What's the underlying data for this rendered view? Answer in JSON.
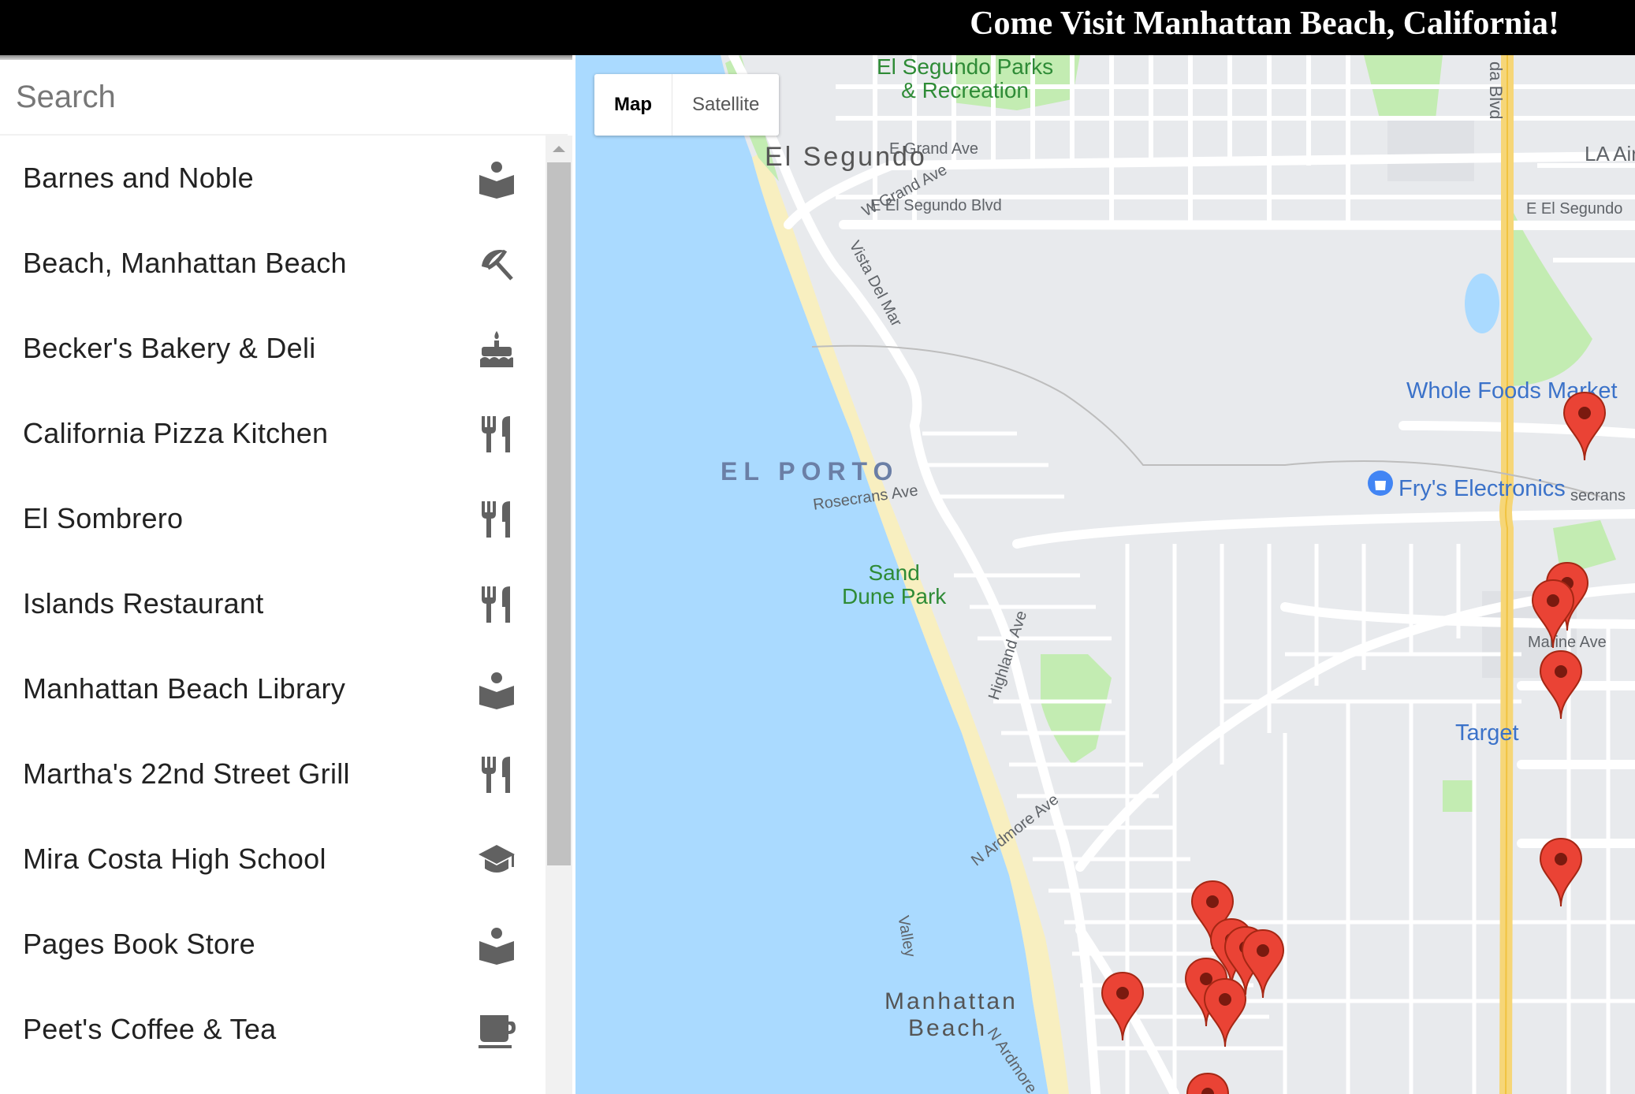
{
  "header": {
    "title": "Come Visit Manhattan Beach, California!"
  },
  "search": {
    "placeholder": "Search"
  },
  "places": [
    {
      "name": "Barnes and Noble",
      "icon": "book-icon"
    },
    {
      "name": "Beach, Manhattan Beach",
      "icon": "beach-umbrella-icon"
    },
    {
      "name": "Becker's Bakery & Deli",
      "icon": "cake-icon"
    },
    {
      "name": "California Pizza Kitchen",
      "icon": "restaurant-icon"
    },
    {
      "name": "El Sombrero",
      "icon": "restaurant-icon"
    },
    {
      "name": "Islands Restaurant",
      "icon": "restaurant-icon"
    },
    {
      "name": "Manhattan Beach Library",
      "icon": "book-icon"
    },
    {
      "name": "Martha's 22nd Street Grill",
      "icon": "restaurant-icon"
    },
    {
      "name": "Mira Costa High School",
      "icon": "school-icon"
    },
    {
      "name": "Pages Book Store",
      "icon": "book-icon"
    },
    {
      "name": "Peet's Coffee & Tea",
      "icon": "coffee-icon"
    }
  ],
  "map": {
    "map_type_buttons": {
      "map": "Map",
      "satellite": "Satellite"
    },
    "labels": {
      "el_segundo_parks_1": "El Segundo Parks",
      "el_segundo_parks_2": "& Recreation",
      "el_segundo": "El Segundo",
      "e_grand_ave": "E Grand Ave",
      "la_air": "LA Air",
      "w_grand_ave": "W Grand Ave",
      "e_el_segundo_blvd": "E El Segundo Blvd",
      "e_el_segundo_right": "E El Segundo",
      "vista_del_mar": "Vista Del Mar",
      "da_blvd": "da Blvd",
      "whole_foods": "Whole Foods Market",
      "el_porto": "EL PORTO",
      "frys": "Fry's Electronics",
      "rosecrans_ave": "Rosecrans Ave",
      "rosecrans_right": "secrans",
      "sand_dune_1": "Sand",
      "sand_dune_2": "Dune Park",
      "highland_ave": "Highland Ave",
      "n_ardmore_ave": "N Ardmore Ave",
      "marine_ave": "Marine Ave",
      "target": "Target",
      "manhattan_beach_1": "Manhattan",
      "manhattan_beach_2": "Beach",
      "n_ardmore": "N Ardmore",
      "valley": "Valley"
    },
    "marker_count": 13,
    "colors": {
      "water": "#aadaff",
      "land": "#e8eaed",
      "park": "#c3ecb2",
      "sand": "#f8efc0",
      "highway": "#f6d678",
      "marker": "#ea4335"
    }
  }
}
